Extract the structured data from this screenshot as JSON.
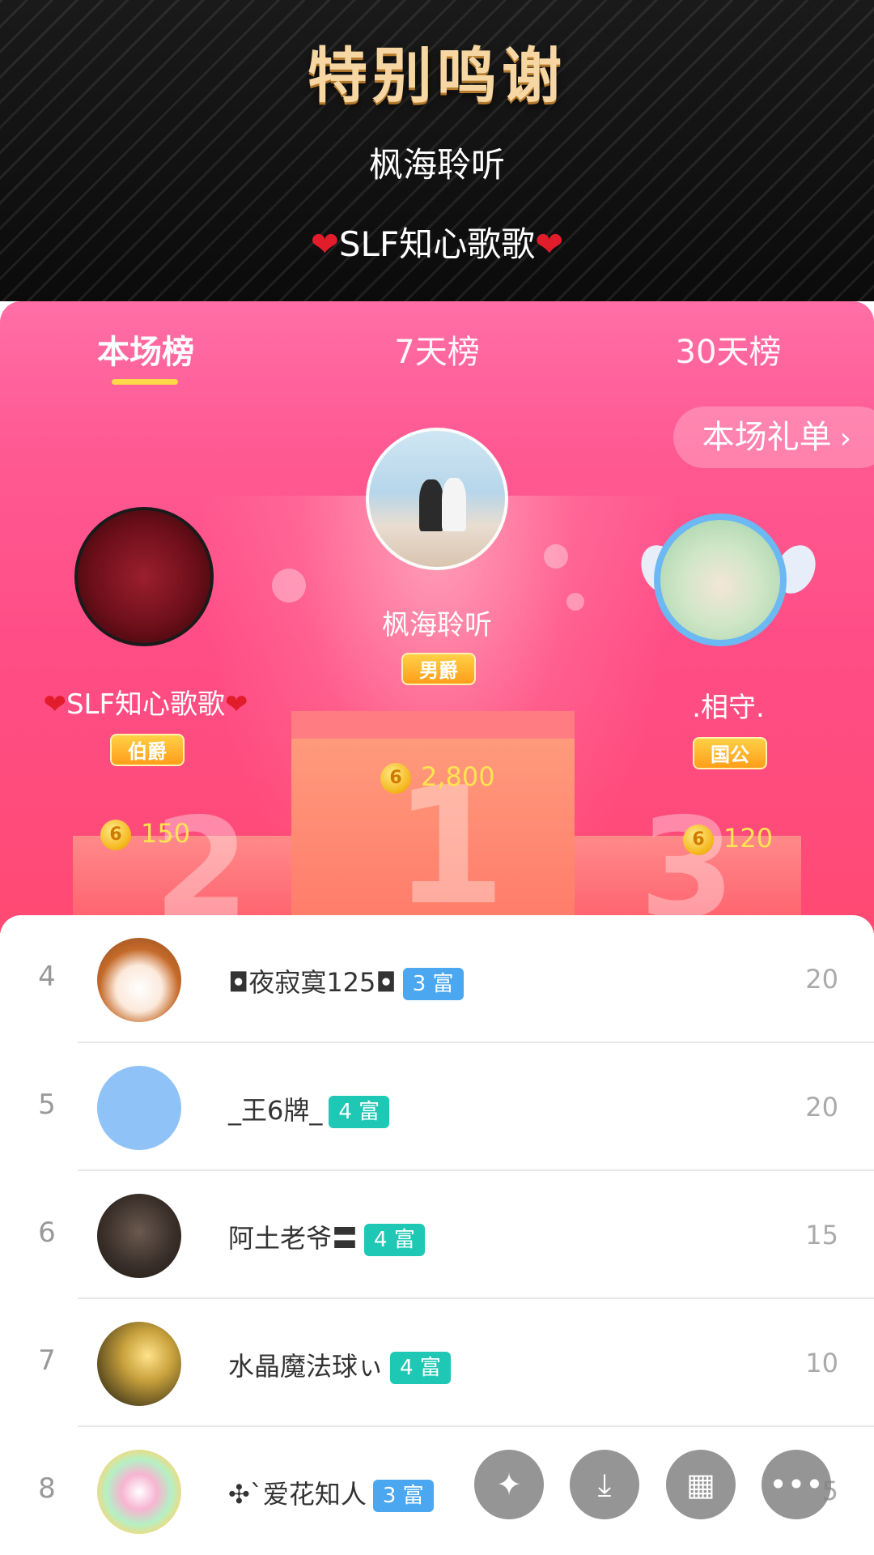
{
  "header": {
    "title": "特别鸣谢",
    "thanks_line1": "枫海聆听",
    "thanks_line2_heart_left": "❤",
    "thanks_line2_name": "SLF知心歌歌",
    "thanks_line2_heart_right": "❤"
  },
  "tabs": [
    {
      "label": "本场榜",
      "active": true
    },
    {
      "label": "7天榜",
      "active": false
    },
    {
      "label": "30天榜",
      "active": false
    }
  ],
  "gift_list_button": {
    "label": "本场礼单",
    "chevron": "›"
  },
  "podium": {
    "first": {
      "name": "枫海聆听",
      "noble": "男爵",
      "coins": "2,800",
      "rank_number": "1"
    },
    "second": {
      "name_heart_left": "❤",
      "name": "SLF知心歌歌",
      "name_heart_right": "❤",
      "noble": "伯爵",
      "coins": "150",
      "rank_number": "2"
    },
    "third": {
      "name": ".相守.",
      "noble": "国公",
      "coins": "120",
      "rank_number": "3"
    },
    "coin_glyph": "6"
  },
  "list": [
    {
      "rank": "4",
      "name": "◘夜寂寞125◘",
      "wealth": "3 富",
      "wealth_color": "#4aa7f0",
      "score": "20"
    },
    {
      "rank": "5",
      "name": "_王6牌_",
      "wealth": "4 富",
      "wealth_color": "#1fc8b5",
      "score": "20"
    },
    {
      "rank": "6",
      "name": "阿土老爷〓",
      "wealth": "4 富",
      "wealth_color": "#1fc8b5",
      "score": "15"
    },
    {
      "rank": "7",
      "name": "水晶魔法球ぃ",
      "wealth": "4 富",
      "wealth_color": "#1fc8b5",
      "score": "10"
    },
    {
      "rank": "8",
      "name": "✣`爱花知人",
      "wealth": "3 富",
      "wealth_color": "#4aa7f0",
      "score": "5"
    }
  ],
  "actions": {
    "share_icon": "✦",
    "download_icon": "⤓",
    "grid_icon": "▦",
    "more_icon": "•••"
  }
}
